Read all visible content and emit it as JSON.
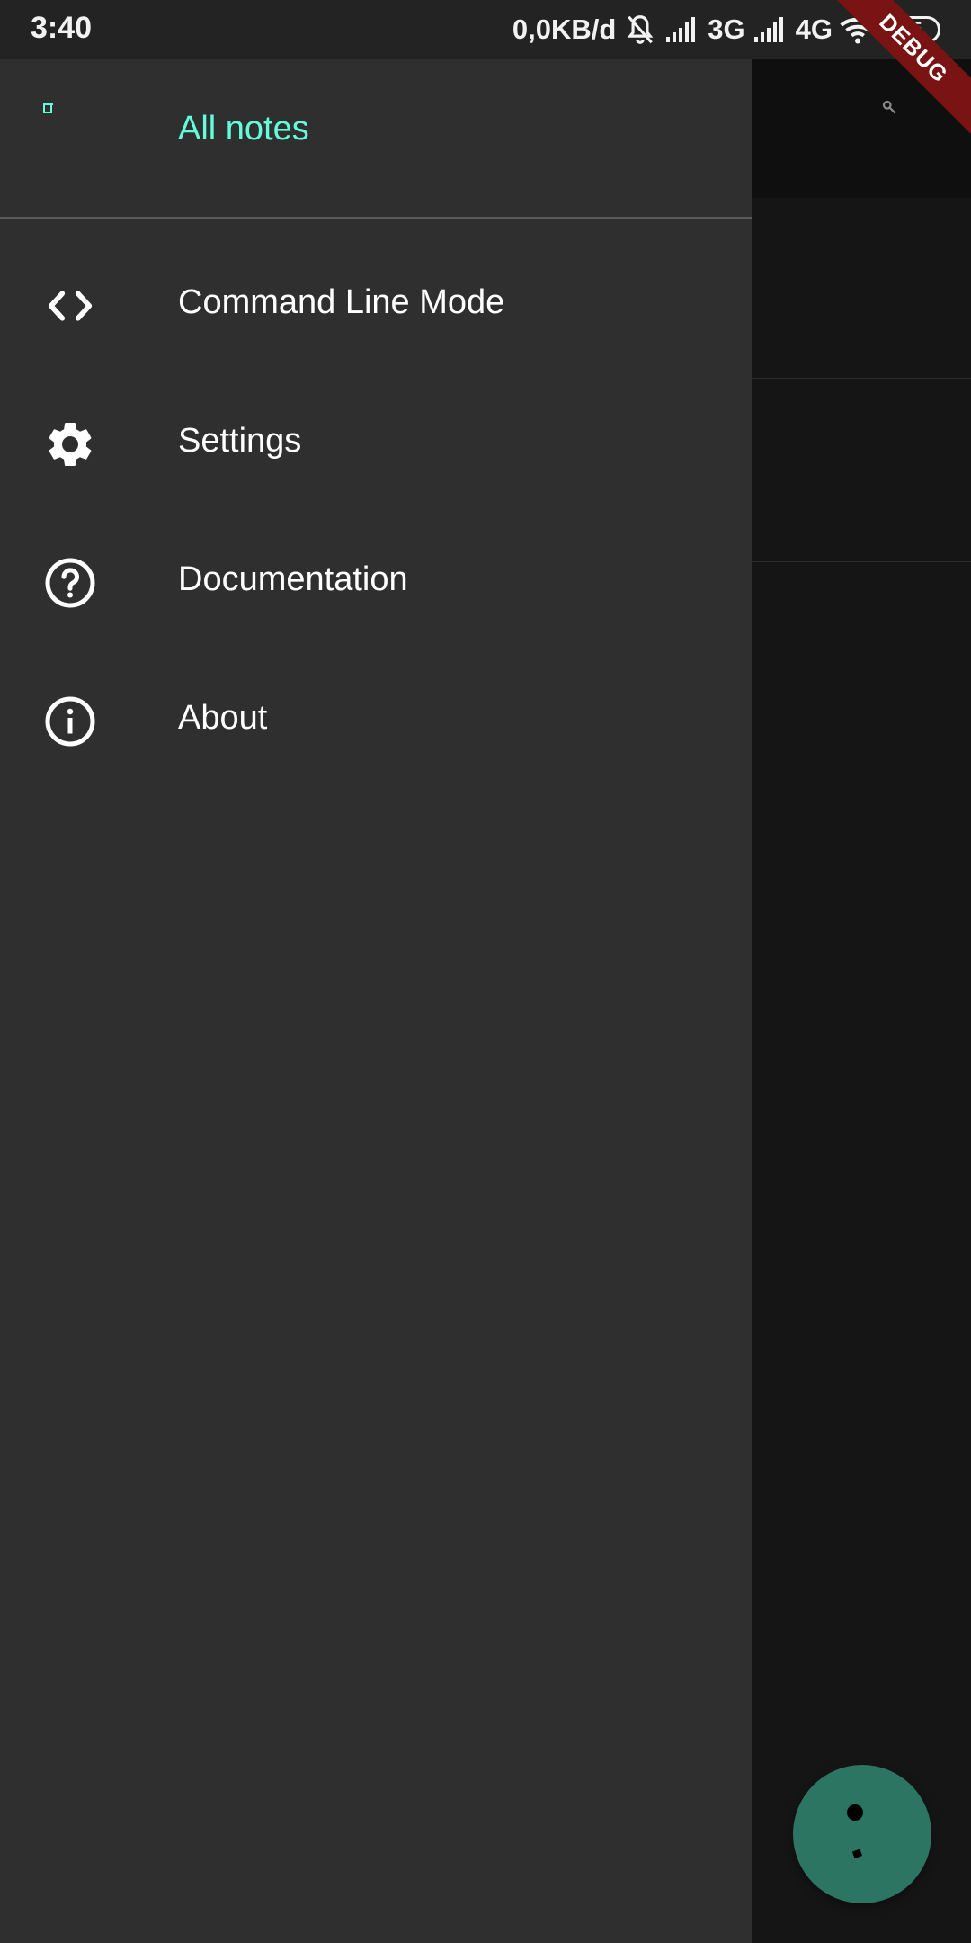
{
  "status_bar": {
    "time": "3:40",
    "data_rate": "0,0KB/d",
    "network_1": "3G",
    "network_2": "4G",
    "battery": "35"
  },
  "debug_banner": "DEBUG",
  "drawer": {
    "header_title": "All notes",
    "items": [
      {
        "label": "Command Line Mode",
        "icon": "code-icon"
      },
      {
        "label": "Settings",
        "icon": "gear-icon"
      },
      {
        "label": "Documentation",
        "icon": "help-circle-icon"
      },
      {
        "label": "About",
        "icon": "info-circle-icon"
      }
    ]
  },
  "colors": {
    "accent": "#64ffda",
    "drawer_bg": "#2f2f2f",
    "fab": "#2c7563",
    "debug": "#7a1414"
  }
}
